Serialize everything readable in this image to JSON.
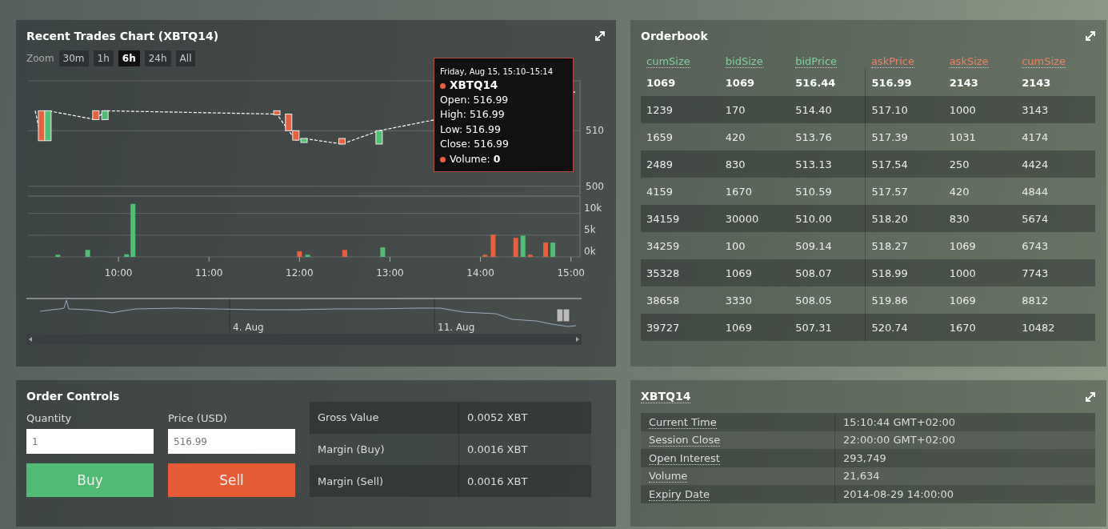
{
  "chart_panel": {
    "title": "Recent Trades Chart (XBTQ14)",
    "zoom": {
      "label": "Zoom",
      "buttons": [
        {
          "label": "30m",
          "selected": false
        },
        {
          "label": "1h",
          "selected": false
        },
        {
          "label": "6h",
          "selected": true
        },
        {
          "label": "24h",
          "selected": false
        },
        {
          "label": "All",
          "selected": false
        }
      ]
    },
    "price_chart": {
      "chart_data": {
        "type": "line",
        "x": [
          9.08,
          9.15,
          9.22,
          9.75,
          9.85,
          11.75,
          11.88,
          11.96,
          12.05,
          12.47,
          12.88,
          14.6,
          15.05
        ],
        "series": [
          {
            "color": "#ffffff",
            "line_style": "dashed",
            "values": [
              513.6,
              508.2,
              513.6,
              512.0,
              513.6,
              513.0,
              510.0,
              508.3,
              508.6,
              507.6,
              510.0,
              null,
              517.0
            ]
          }
        ],
        "xlim": [
          9.0,
          15.1
        ],
        "ylim": [
          498.5,
          519
        ],
        "yticks": [
          500,
          510
        ]
      }
    },
    "volume_chart": {
      "chart_data": {
        "type": "bar",
        "x": [
          9.33,
          9.66,
          10.09,
          10.16,
          12.0,
          12.09,
          12.5,
          12.92,
          14.05,
          14.14,
          14.39,
          14.47,
          14.55,
          14.72,
          14.8
        ],
        "series": [
          {
            "color": "#4fbf73",
            "values": [
              0.5,
              1.6,
              0.6,
              12.2,
              null,
              0.5,
              null,
              2.2,
              null,
              null,
              null,
              4.9,
              null,
              null,
              3.3
            ]
          },
          {
            "color": "#e8603c",
            "values": [
              null,
              null,
              null,
              null,
              1.3,
              null,
              1.6,
              null,
              0.5,
              5.1,
              4.4,
              null,
              0.5,
              3.3,
              null
            ]
          }
        ],
        "xlim": [
          9.0,
          15.1
        ],
        "ylim": [
          0,
          14
        ],
        "yticks": [
          {
            "value": 0,
            "label": "0k"
          },
          {
            "value": 5,
            "label": "5k"
          },
          {
            "value": 10,
            "label": "10k"
          }
        ],
        "xticks": [
          {
            "value": 10,
            "label": "10:00"
          },
          {
            "value": 11,
            "label": "11:00"
          },
          {
            "value": 12,
            "label": "12:00"
          },
          {
            "value": 13,
            "label": "13:00"
          },
          {
            "value": 14,
            "label": "14:00"
          },
          {
            "value": 15,
            "label": "15:00"
          }
        ]
      }
    },
    "navigator": {
      "labels": [
        "4. Aug",
        "11. Aug"
      ]
    },
    "tooltip": {
      "header": "Friday, Aug 15, 15:10–15:14",
      "items": [
        {
          "kind": "series",
          "text": "**XBTQ14**"
        },
        {
          "kind": "value",
          "text": "Open: 516.99"
        },
        {
          "kind": "value",
          "text": "High: 516.99"
        },
        {
          "kind": "value",
          "text": "Low: 516.99"
        },
        {
          "kind": "value",
          "text": "Close: 516.99"
        },
        {
          "kind": "volume",
          "text": "Volume: **0**"
        }
      ]
    }
  },
  "orderbook": {
    "title": "Orderbook",
    "columns": [
      {
        "label": "cumSize",
        "color": "#7fd19a"
      },
      {
        "label": "bidSize",
        "color": "#7fd19a"
      },
      {
        "label": "bidPrice",
        "color": "#7fd19a"
      },
      {
        "label": "askPrice",
        "color": "#ee8060"
      },
      {
        "label": "askSize",
        "color": "#ee8060"
      },
      {
        "label": "cumSize",
        "color": "#ee8060"
      }
    ],
    "rows": [
      {
        "best": true,
        "cells": [
          "1069",
          "1069",
          "516.44",
          "516.99",
          "2143",
          "2143"
        ]
      },
      {
        "best": false,
        "cells": [
          "1239",
          "170",
          "514.40",
          "517.10",
          "1000",
          "3143"
        ]
      },
      {
        "best": false,
        "cells": [
          "1659",
          "420",
          "513.76",
          "517.39",
          "1031",
          "4174"
        ]
      },
      {
        "best": false,
        "cells": [
          "2489",
          "830",
          "513.13",
          "517.54",
          "250",
          "4424"
        ]
      },
      {
        "best": false,
        "cells": [
          "4159",
          "1670",
          "510.59",
          "517.57",
          "420",
          "4844"
        ]
      },
      {
        "best": false,
        "cells": [
          "34159",
          "30000",
          "510.00",
          "518.20",
          "830",
          "5674"
        ]
      },
      {
        "best": false,
        "cells": [
          "34259",
          "100",
          "509.14",
          "518.27",
          "1069",
          "6743"
        ]
      },
      {
        "best": false,
        "cells": [
          "35328",
          "1069",
          "508.07",
          "518.99",
          "1000",
          "7743"
        ]
      },
      {
        "best": false,
        "cells": [
          "38658",
          "3330",
          "508.05",
          "519.86",
          "1069",
          "8812"
        ]
      },
      {
        "best": false,
        "cells": [
          "39727",
          "1069",
          "507.31",
          "520.74",
          "1670",
          "10482"
        ]
      }
    ]
  },
  "order_controls": {
    "title": "Order Controls",
    "fields": [
      {
        "label": "Quantity",
        "value": "1"
      },
      {
        "label": "Price (USD)",
        "value": "516.99"
      }
    ],
    "buttons": [
      {
        "label": "Buy",
        "kind": "buy"
      },
      {
        "label": "Sell",
        "kind": "sell"
      }
    ],
    "summary": [
      {
        "label": "Gross Value",
        "value": "0.0052 XBT"
      },
      {
        "label": "Margin (Buy)",
        "value": "0.0016 XBT"
      },
      {
        "label": "Margin (Sell)",
        "value": "0.0016 XBT"
      }
    ]
  },
  "instrument": {
    "title": "XBTQ14",
    "rows": [
      {
        "label": "Current Time",
        "value": "15:10:44 GMT+02:00"
      },
      {
        "label": "Session Close",
        "value": "22:00:00 GMT+02:00"
      },
      {
        "label": "Open Interest",
        "value": "293,749"
      },
      {
        "label": "Volume",
        "value": "21,634"
      },
      {
        "label": "Expiry Date",
        "value": "2014-08-29 14:00:00"
      }
    ]
  }
}
